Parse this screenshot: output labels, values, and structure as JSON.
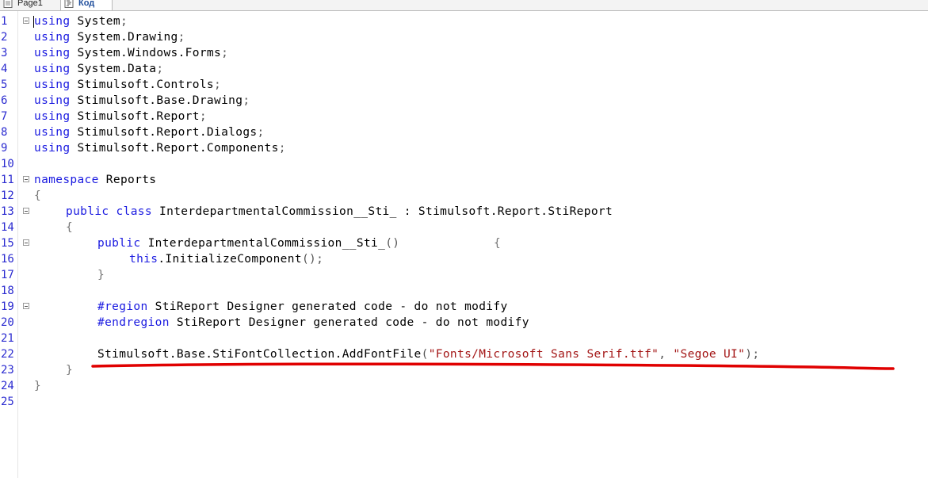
{
  "tabs": [
    {
      "label": "Page1",
      "icon": "page-icon",
      "active": false
    },
    {
      "label": "Код",
      "icon": "code-icon",
      "active": true
    }
  ],
  "editor": {
    "line_numbers": [
      "1",
      "2",
      "3",
      "4",
      "5",
      "6",
      "7",
      "8",
      "9",
      "10",
      "11",
      "12",
      "13",
      "14",
      "15",
      "16",
      "17",
      "18",
      "19",
      "20",
      "21",
      "22",
      "23",
      "24",
      "25"
    ],
    "lines": {
      "l1": {
        "kw": "using",
        "rest": " System",
        "punct": ";"
      },
      "l2": {
        "kw": "using",
        "rest": " System.Drawing",
        "punct": ";"
      },
      "l3": {
        "kw": "using",
        "rest": " System.Windows.Forms",
        "punct": ";"
      },
      "l4": {
        "kw": "using",
        "rest": " System.Data",
        "punct": ";"
      },
      "l5": {
        "kw": "using",
        "rest": " Stimulsoft.Controls",
        "punct": ";"
      },
      "l6": {
        "kw": "using",
        "rest": " Stimulsoft.Base.Drawing",
        "punct": ";"
      },
      "l7": {
        "kw": "using",
        "rest": " Stimulsoft.Report",
        "punct": ";"
      },
      "l8": {
        "kw": "using",
        "rest": " Stimulsoft.Report.Dialogs",
        "punct": ";"
      },
      "l9": {
        "kw": "using",
        "rest": " Stimulsoft.Report.Components",
        "punct": ";"
      },
      "l11": {
        "kw": "namespace",
        "rest": " Reports"
      },
      "l12": {
        "brace": "{"
      },
      "l13": {
        "kw": "public class",
        "rest": " InterdepartmentalCommission__Sti_ : Stimulsoft.Report.StiReport"
      },
      "l14": {
        "brace": "{"
      },
      "l15": {
        "kw": "public",
        "rest": " InterdepartmentalCommission__Sti_",
        "punct": "()",
        "brace": "{"
      },
      "l16": {
        "kw": "this",
        "rest": ".InitializeComponent",
        "punct": "();"
      },
      "l17": {
        "brace": "}"
      },
      "l19": {
        "kw": "#region",
        "rest": " StiReport Designer generated code - do not modify"
      },
      "l20": {
        "kw": "#endregion",
        "rest": " StiReport Designer generated code - do not modify"
      },
      "l22": {
        "call": "Stimulsoft.Base.StiFontCollection.AddFontFile",
        "p1": "(",
        "s1": "\"Fonts/Microsoft Sans Serif.ttf\"",
        "p2": ", ",
        "s2": "\"Segoe UI\"",
        "p3": ");"
      },
      "l23": {
        "brace": "}"
      },
      "l24": {
        "brace": "}"
      }
    }
  },
  "colors": {
    "keyword": "#1a1ae0",
    "string": "#a31515",
    "line_number": "#2b2bd0",
    "annotation": "#e00000"
  }
}
